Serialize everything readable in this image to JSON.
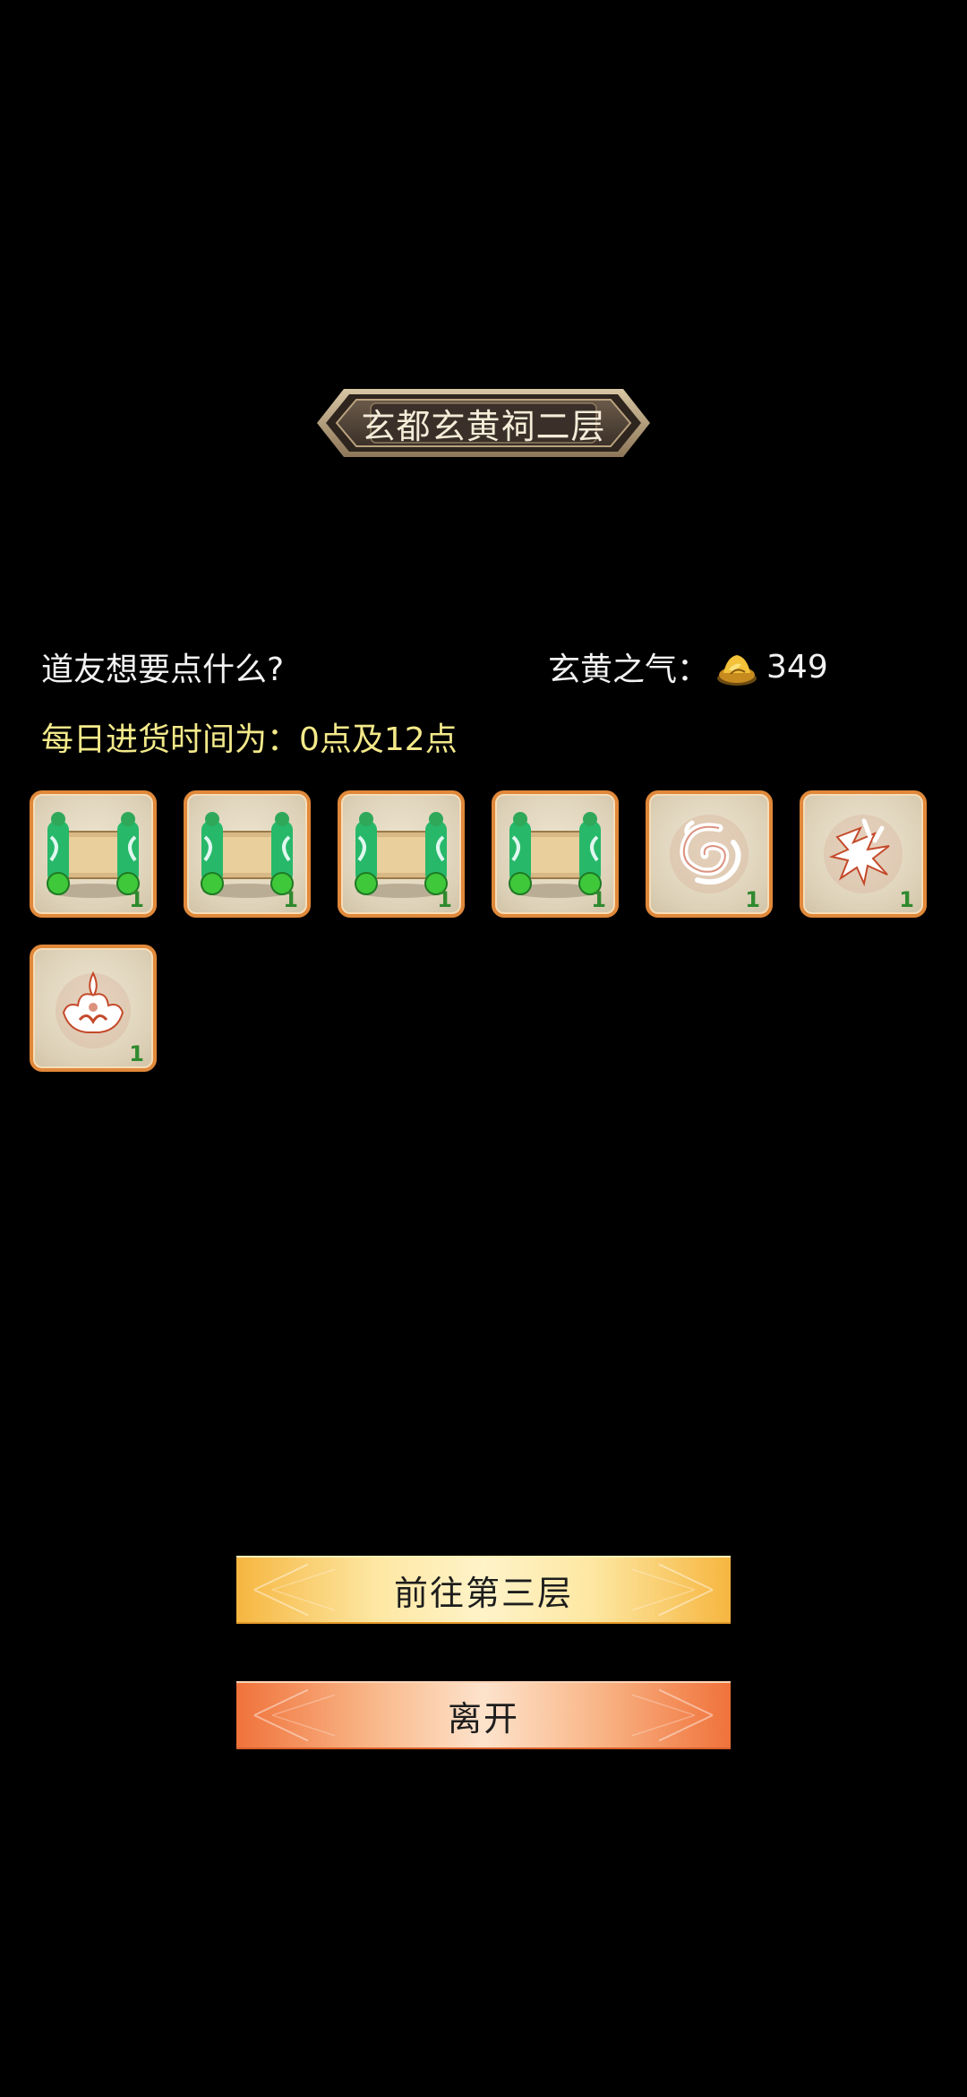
{
  "title": "玄都玄黄祠二层",
  "prompt": "道友想要点什么?",
  "currency": {
    "label": "玄黄之气：",
    "icon": "gold-ingot-icon",
    "amount": "349"
  },
  "restock_text": "每日进货时间为：0点及12点",
  "items": [
    {
      "icon": "scroll-icon",
      "count": "1"
    },
    {
      "icon": "scroll-icon",
      "count": "1"
    },
    {
      "icon": "scroll-icon",
      "count": "1"
    },
    {
      "icon": "scroll-icon",
      "count": "1"
    },
    {
      "icon": "swirl-rune-icon",
      "count": "1"
    },
    {
      "icon": "claw-rune-icon",
      "count": "1"
    },
    {
      "icon": "flame-rune-icon",
      "count": "1"
    }
  ],
  "buttons": {
    "next_floor": "前往第三层",
    "leave": "离开"
  },
  "colors": {
    "background": "#000000",
    "restock_text": "#f3e98a",
    "slot_border": "#e0883a",
    "count_text": "#2f8a2f",
    "next_button": "#f6b640",
    "leave_button": "#f0723a"
  }
}
